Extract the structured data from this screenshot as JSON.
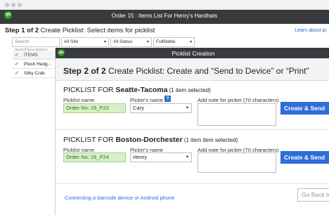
{
  "window": {
    "title": "Order 15 : Items List For Henry's Hardhats"
  },
  "app": {
    "logo": "qb",
    "brand_color": "#2ca01c",
    "header_color": "#393a3d",
    "accent_color": "#2d6ed8"
  },
  "step1": {
    "bold": "Step 1 of 2",
    "text": " Create Picklist: Select items for picklist",
    "learn_link": "Learn about pi"
  },
  "filters": {
    "search_placeholder": "Search Item/Description",
    "site": "All Site",
    "status": "All Status",
    "fulfillable": "Fulfillable"
  },
  "items_table": {
    "header": "ITEMS",
    "rows": [
      {
        "checked": true,
        "name": "Plush Hedg..."
      },
      {
        "checked": true,
        "name": "Silky Crab"
      }
    ]
  },
  "modal": {
    "title": "Picklist Creation",
    "step_bold": "Step 2 of 2",
    "step_text": " Create Picklist: Create and “Send to Device” or “Print”",
    "picklists": [
      {
        "prefix": "PICKLIST FOR ",
        "location": "Seatte-Tacoma",
        "count_text": " (1 item selected)",
        "picklist_name_label": "Picklist name",
        "picklist_name_value": "Order No: 15_P22",
        "pickers_name_label": "Picker's name",
        "picker_value": "Cary",
        "note_label": "Add note for picker (70 characters)",
        "note_value": "",
        "button_label": "Create & Send"
      },
      {
        "prefix": "PICKLIST FOR ",
        "location": "Boston-Dorchester",
        "count_text": " (1 item item selected)",
        "picklist_name_label": "Picklist name",
        "picklist_name_value": "Order No: 16_P24",
        "pickers_name_label": "Picker's name",
        "picker_value": "Henry",
        "note_label": "Add note for picker (70 characters)",
        "note_value": "",
        "button_label": "Create & Send"
      }
    ],
    "footer_link": "Connecting a barcode device or Android phone",
    "go_back": "Go Back to"
  },
  "icons": {
    "help": "?",
    "caret": "▾",
    "check": "✓"
  }
}
